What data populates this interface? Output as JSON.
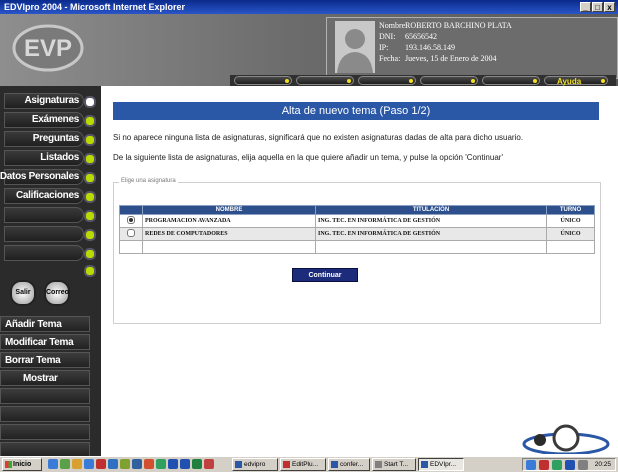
{
  "window": {
    "title": "EDVIpro 2004 - Microsoft Internet Explorer",
    "buttons": [
      "_",
      "□",
      "x"
    ]
  },
  "user": {
    "labels": {
      "name": "Nombre:",
      "dni": "DNI:",
      "ip": "IP:",
      "date": "Fecha:"
    },
    "name": "ROBERTO BARCHINO PLATA",
    "dni": "65656542",
    "ip": "193.146.58.149",
    "date": "Jueves, 15 de Enero de 2004"
  },
  "topnav": {
    "help_label": "Ayuda"
  },
  "sidebar": {
    "menu": [
      "Asignaturas",
      "Exámenes",
      "Preguntas",
      "Listados",
      "Datos Personales",
      "Calificaciones"
    ],
    "active": "Asignaturas",
    "salir": "Salir",
    "correo": "Correo",
    "submenu": [
      "Añadir Tema",
      "Modificar Tema",
      "Borrar Tema",
      "Mostrar"
    ]
  },
  "main": {
    "title": "Alta de nuevo tema (Paso 1/2)",
    "message1": "Si no aparece ninguna lista de asignaturas, significará que no existen asignaturas dadas de alta para dicho usuario.",
    "message2": "De la siguiente lista de asignaturas, elija aquella en la que quiere añadir un tema, y pulse la opción 'Continuar'",
    "fieldset_legend": "Elige una asignatura",
    "columns": [
      "NOMBRE",
      "TITULACIÓN",
      "TURNO"
    ],
    "rows": [
      {
        "name": "PROGRAMACION AVANZADA",
        "titulacion": "ING. TEC. EN INFORMÁTICA DE GESTIÓN",
        "turno": "ÚNICO",
        "selected": true
      },
      {
        "name": "REDES DE COMPUTADORES",
        "titulacion": "ING. TEC. EN INFORMÁTICA DE GESTIÓN",
        "turno": "ÚNICO",
        "selected": false
      }
    ],
    "continue_label": "Continuar"
  },
  "taskbar": {
    "start": "Inicio",
    "tasks": [
      "edvipro",
      "EditPlu...",
      "confer...",
      "Start T...",
      "EDVIpr..."
    ],
    "clock": "20:25"
  },
  "colors": {
    "accent": "#2a57a6",
    "menu_dot": "#bada00",
    "button": "#1c2b7a"
  }
}
